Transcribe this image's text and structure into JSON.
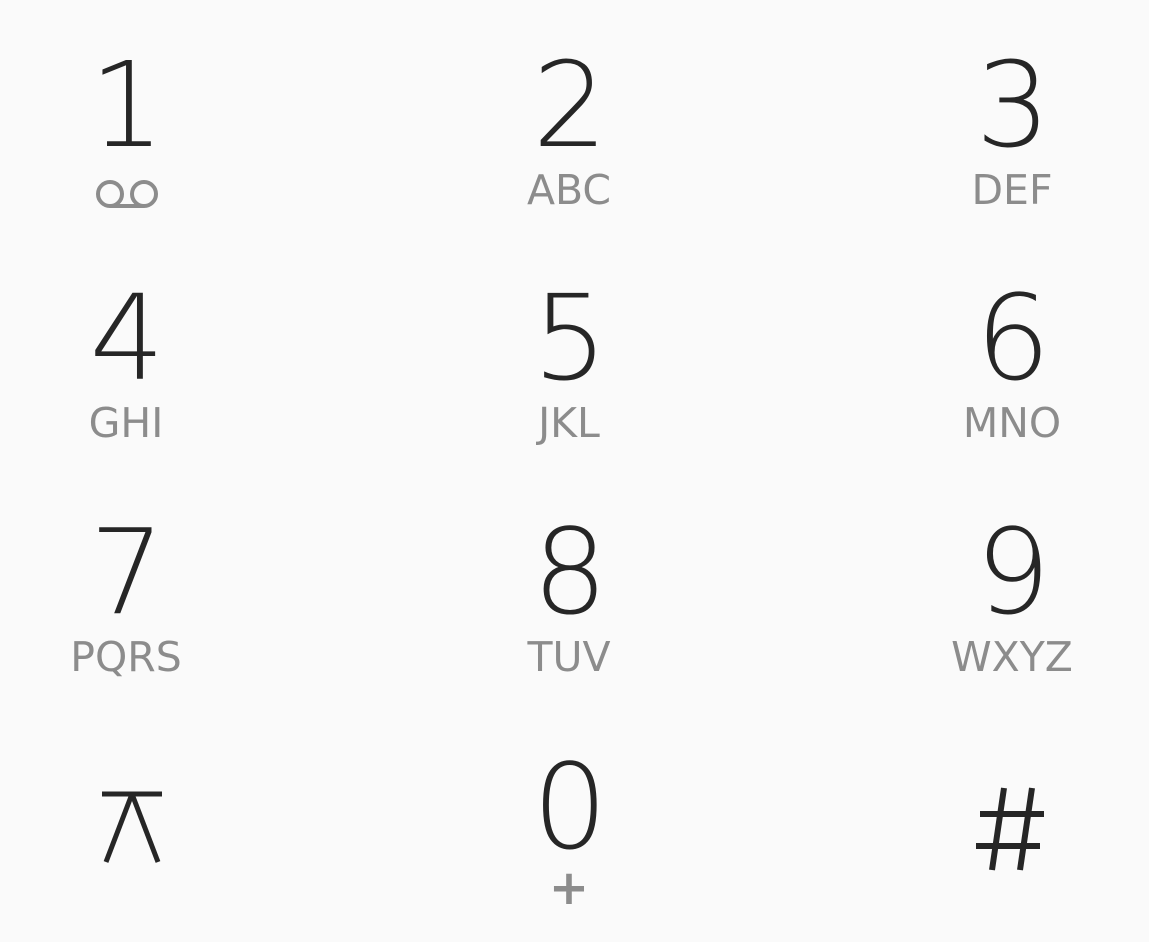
{
  "dialpad": {
    "keys": [
      {
        "digit": "1",
        "sub": "",
        "sub_icon": "voicemail-icon"
      },
      {
        "digit": "2",
        "sub": "ABC"
      },
      {
        "digit": "3",
        "sub": "DEF"
      },
      {
        "digit": "4",
        "sub": "GHI"
      },
      {
        "digit": "5",
        "sub": "JKL"
      },
      {
        "digit": "6",
        "sub": "MNO"
      },
      {
        "digit": "7",
        "sub": "PQRS"
      },
      {
        "digit": "8",
        "sub": "TUV"
      },
      {
        "digit": "9",
        "sub": "WXYZ"
      },
      {
        "digit": "*",
        "sub": "",
        "icon": "asterisk-icon"
      },
      {
        "digit": "0",
        "sub": "+"
      },
      {
        "digit": "#",
        "sub": "",
        "icon": "hash-icon"
      }
    ],
    "colors": {
      "background": "#fafafa",
      "digit": "#262626",
      "subtext": "#8c8c8c"
    }
  }
}
